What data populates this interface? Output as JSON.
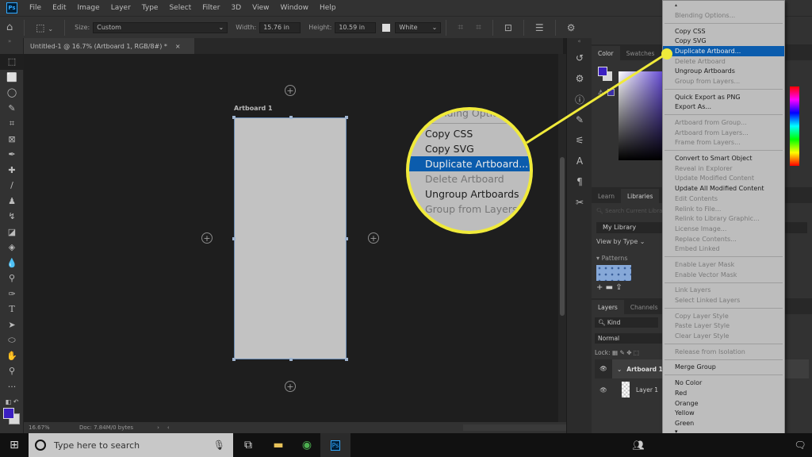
{
  "app": {
    "logo": "Ps"
  },
  "menubar": [
    "File",
    "Edit",
    "Image",
    "Layer",
    "Type",
    "Select",
    "Filter",
    "3D",
    "View",
    "Window",
    "Help"
  ],
  "options": {
    "size_label": "Size:",
    "size_value": "Custom",
    "width_label": "Width:",
    "width_value": "15.76 in",
    "height_label": "Height:",
    "height_value": "10.59 in",
    "fill_value": "White"
  },
  "document": {
    "tab_title": "Untitled-1 @ 16.7% (Artboard 1, RGB/8#) *",
    "close": "×",
    "artboard_label": "Artboard 1",
    "zoom_level": "16.67%",
    "doc_info": "Doc: 7.84M/0 bytes"
  },
  "colors": {
    "foreground": "#3b1fc2",
    "background": "#d8d8d8",
    "highlight": "#0b5cad",
    "callout": "#f0ea3a"
  },
  "panels": {
    "color_tabs": [
      "Color",
      "Swatches"
    ],
    "library_tabs": [
      "Learn",
      "Libraries"
    ],
    "library_search_placeholder": "Search Current Library",
    "library_name": "My Library",
    "view_by": "View by Type",
    "patterns_label": "Patterns",
    "layer_tabs": [
      "Layers",
      "Channels"
    ],
    "kind_filter": "Kind",
    "blend_mode": "Normal",
    "lock_label": "Lock:",
    "layers": [
      {
        "name": "Artboard 1",
        "type": "artboard"
      },
      {
        "name": "Layer 1",
        "type": "layer"
      }
    ]
  },
  "context_menu": {
    "groups": [
      [
        {
          "label": "Blending Options...",
          "enabled": false
        }
      ],
      [
        {
          "label": "Copy CSS",
          "enabled": true
        },
        {
          "label": "Copy SVG",
          "enabled": true
        },
        {
          "label": "Duplicate Artboard...",
          "enabled": true,
          "selected": true
        },
        {
          "label": "Delete Artboard",
          "enabled": false
        },
        {
          "label": "Ungroup Artboards",
          "enabled": true
        },
        {
          "label": "Group from Layers...",
          "enabled": false
        }
      ],
      [
        {
          "label": "Quick Export as PNG",
          "enabled": true
        },
        {
          "label": "Export As...",
          "enabled": true
        }
      ],
      [
        {
          "label": "Artboard from Group...",
          "enabled": false
        },
        {
          "label": "Artboard from Layers...",
          "enabled": false
        },
        {
          "label": "Frame from Layers...",
          "enabled": false
        }
      ],
      [
        {
          "label": "Convert to Smart Object",
          "enabled": true
        },
        {
          "label": "Reveal in Explorer",
          "enabled": false
        },
        {
          "label": "Update Modified Content",
          "enabled": false
        },
        {
          "label": "Update All Modified Content",
          "enabled": true
        },
        {
          "label": "Edit Contents",
          "enabled": false
        },
        {
          "label": "Relink to File...",
          "enabled": false
        },
        {
          "label": "Relink to Library Graphic...",
          "enabled": false
        },
        {
          "label": "License Image...",
          "enabled": false
        },
        {
          "label": "Replace Contents...",
          "enabled": false
        },
        {
          "label": "Embed Linked",
          "enabled": false
        }
      ],
      [
        {
          "label": "Enable Layer Mask",
          "enabled": false
        },
        {
          "label": "Enable Vector Mask",
          "enabled": false
        }
      ],
      [
        {
          "label": "Link Layers",
          "enabled": false
        },
        {
          "label": "Select Linked Layers",
          "enabled": false
        }
      ],
      [
        {
          "label": "Copy Layer Style",
          "enabled": false
        },
        {
          "label": "Paste Layer Style",
          "enabled": false
        },
        {
          "label": "Clear Layer Style",
          "enabled": false
        }
      ],
      [
        {
          "label": "Release from Isolation",
          "enabled": false
        }
      ],
      [
        {
          "label": "Merge Group",
          "enabled": true
        }
      ],
      [
        {
          "label": "No Color",
          "enabled": true
        },
        {
          "label": "Red",
          "enabled": true
        },
        {
          "label": "Orange",
          "enabled": true
        },
        {
          "label": "Yellow",
          "enabled": true
        },
        {
          "label": "Green",
          "enabled": true
        }
      ]
    ]
  },
  "magnifier": {
    "items": [
      {
        "label": "Blending Options...",
        "enabled": false
      },
      {
        "label": "Copy CSS",
        "enabled": true
      },
      {
        "label": "Copy SVG",
        "enabled": true
      },
      {
        "label": "Duplicate Artboard...",
        "enabled": true,
        "selected": true
      },
      {
        "label": "Delete Artboard",
        "enabled": false
      },
      {
        "label": "Ungroup Artboards",
        "enabled": true
      },
      {
        "label": "Group from Layers...",
        "enabled": false
      }
    ]
  },
  "taskbar": {
    "search_placeholder": "Type here to search"
  }
}
